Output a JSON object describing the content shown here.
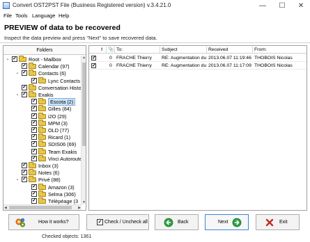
{
  "window": {
    "title": "Convert OST2PST File (Business Registered version) v.3.4.21.0",
    "minimize": "—",
    "maximize": "☐",
    "close": "✕"
  },
  "menu": [
    "File",
    "Tools",
    "Language",
    "Help"
  ],
  "header": {
    "title": "PREVIEW of data to be recovered",
    "subtitle": "Inspect the data preview and press \"Next\" to save recovered data."
  },
  "folders": {
    "heading": "Folders",
    "nodes": [
      {
        "label": "Root - Mailbox",
        "expanded": true,
        "checked": true
      },
      {
        "label": "Calendar  (97)",
        "checked": true
      },
      {
        "label": "Contacts  (6)",
        "expanded": true,
        "checked": true
      },
      {
        "label": "Lync Contacts",
        "checked": true
      },
      {
        "label": "Conversation History",
        "checked": true
      },
      {
        "label": "Exakis",
        "expanded": true,
        "checked": true
      },
      {
        "label": "Escota  (2)",
        "checked": true,
        "selected": true
      },
      {
        "label": "Gilles  (84)",
        "checked": true
      },
      {
        "label": "i2O  (29)",
        "checked": true
      },
      {
        "label": "MPM  (3)",
        "checked": true
      },
      {
        "label": "OLD  (77)",
        "checked": true
      },
      {
        "label": "Ricard  (1)",
        "checked": true
      },
      {
        "label": "SDIS06  (69)",
        "checked": true
      },
      {
        "label": "Team Exakis",
        "checked": true
      },
      {
        "label": "Vinci Autoroutes",
        "checked": true
      },
      {
        "label": "Inbox  (3)",
        "checked": true
      },
      {
        "label": "Notes  (6)",
        "checked": true
      },
      {
        "label": "Privé  (88)",
        "expanded": true,
        "checked": true
      },
      {
        "label": "Amazon  (3)",
        "checked": true
      },
      {
        "label": "Selma  (306)",
        "checked": true
      },
      {
        "label": "Télépéage  (3",
        "checked": true
      }
    ]
  },
  "messages": {
    "columns": {
      "flag": "!",
      "attach": "📎",
      "to": "To:",
      "subject": "Subject",
      "received": "Received",
      "from": "From:"
    },
    "rows": [
      {
        "checked": true,
        "attach": "0",
        "to": "FRACHE Thierry",
        "subject": "RE: Augmentation du m",
        "received": "2013.06.07 11:19:46",
        "from": "THOBOIS Nicolas"
      },
      {
        "checked": true,
        "attach": "0",
        "to": "FRACHE Thierry",
        "subject": "RE: Augmentation du m",
        "received": "2013.06.07 11:17:09",
        "from": "THOBOIS Nicolas"
      }
    ]
  },
  "buttons": {
    "how": "How it works?",
    "check_all": "Check / Uncheck all",
    "back": "Back",
    "next": "Next",
    "exit": "Exit"
  },
  "status": {
    "checked_objects": "Checked objects: 1361"
  },
  "colors": {
    "accent": "#3b86d8",
    "selection": "#cce4f7",
    "folder": "#e7c64a"
  }
}
